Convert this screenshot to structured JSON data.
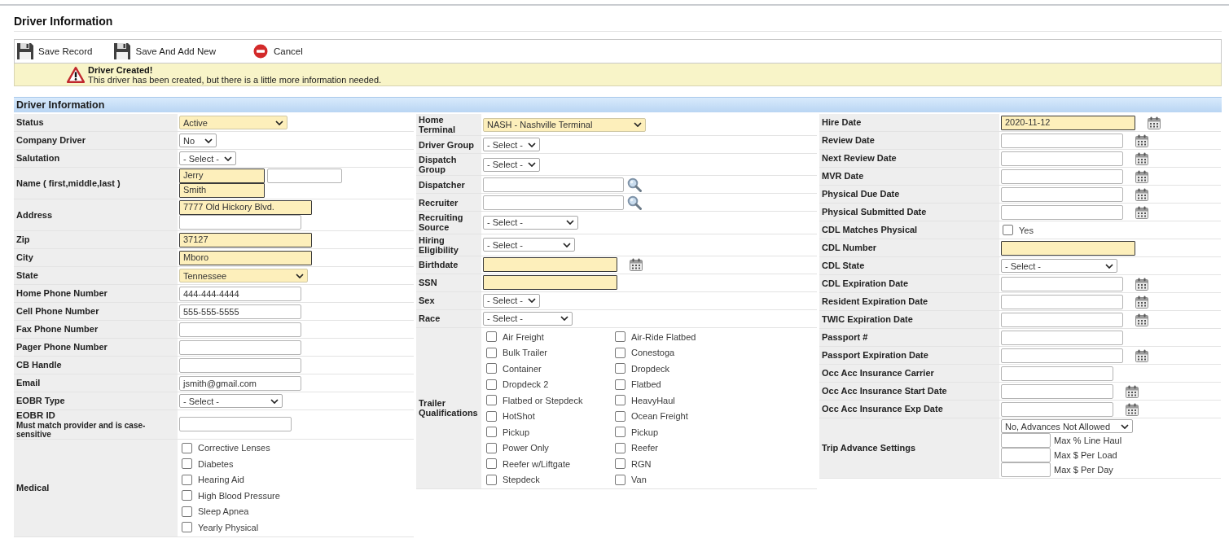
{
  "page": {
    "title": "Driver Information"
  },
  "toolbar": [
    {
      "kind": "save",
      "label": "Save Record"
    },
    {
      "kind": "save",
      "label": "Save And Add New"
    },
    {
      "kind": "cancel",
      "label": "Cancel"
    }
  ],
  "notice": {
    "kind": "warning",
    "title": "Driver Created!",
    "message": "This driver has been created, but there is a little more information needed."
  },
  "section": {
    "title": "Driver Information",
    "columns": [
      {
        "rows": [
          {
            "label": "Status",
            "fields": [
              {
                "kind": "select",
                "value": "Active",
                "required": true
              }
            ]
          },
          {
            "label": "Company Driver",
            "fields": [
              {
                "kind": "select",
                "value": "No",
                "required": false
              }
            ]
          },
          {
            "label": "Salutation",
            "fields": [
              {
                "kind": "select",
                "value": "- Select -",
                "required": false
              }
            ]
          },
          {
            "label": "Name ( first,middle,last )",
            "lines": [
              [
                {
                  "kind": "text",
                  "value": "Jerry",
                  "required": true
                },
                {
                  "kind": "text",
                  "required": false
                }
              ],
              [
                {
                  "kind": "text",
                  "value": "Smith",
                  "required": true
                }
              ]
            ]
          },
          {
            "label": "Address",
            "lines": [
              [
                {
                  "kind": "text",
                  "value": "7777 Old Hickory Blvd.",
                  "required": true
                }
              ],
              [
                {
                  "kind": "text",
                  "required": false
                }
              ]
            ]
          },
          {
            "label": "Zip",
            "fields": [
              {
                "kind": "text",
                "value": "37127",
                "required": true
              }
            ]
          },
          {
            "label": "City",
            "fields": [
              {
                "kind": "text",
                "value": "Mboro",
                "required": true
              }
            ]
          },
          {
            "label": "State",
            "fields": [
              {
                "kind": "select",
                "value": "Tennessee",
                "required": true
              }
            ]
          },
          {
            "label": "Home Phone Number",
            "fields": [
              {
                "kind": "text",
                "value": "444-444-4444",
                "required": false
              }
            ]
          },
          {
            "label": "Cell Phone Number",
            "fields": [
              {
                "kind": "text",
                "value": "555-555-5555",
                "required": false
              }
            ]
          },
          {
            "label": "Fax Phone Number",
            "fields": [
              {
                "kind": "text",
                "required": false
              }
            ]
          },
          {
            "label": "Pager Phone Number",
            "fields": [
              {
                "kind": "text",
                "required": false
              }
            ]
          },
          {
            "label": "CB Handle",
            "fields": [
              {
                "kind": "text",
                "required": false
              }
            ]
          },
          {
            "label": "Email",
            "fields": [
              {
                "kind": "text",
                "value": "jsmith@gmail.com",
                "required": false
              }
            ]
          },
          {
            "label": "EOBR Type",
            "fields": [
              {
                "kind": "select",
                "value": "- Select -",
                "required": false
              }
            ]
          },
          {
            "label": "EOBR ID",
            "note": "Must match provider and is case-sensitive",
            "fields": [
              {
                "kind": "text",
                "required": false
              }
            ]
          },
          {
            "label": "Medical",
            "fields": [
              {
                "kind": "checklist",
                "items": [
                  {
                    "label": "Corrective Lenses",
                    "checked": false
                  },
                  {
                    "label": "Diabetes",
                    "checked": false
                  },
                  {
                    "label": "Hearing Aid",
                    "checked": false
                  },
                  {
                    "label": "High Blood Pressure",
                    "checked": false
                  },
                  {
                    "label": "Sleep Apnea",
                    "checked": false
                  },
                  {
                    "label": "Yearly Physical",
                    "checked": false
                  }
                ]
              }
            ]
          }
        ]
      },
      {
        "rows": [
          {
            "label": "Home Terminal",
            "fields": [
              {
                "kind": "select",
                "value": "NASH - Nashville Terminal",
                "required": true
              }
            ]
          },
          {
            "label": "Driver Group",
            "fields": [
              {
                "kind": "select",
                "value": "- Select -",
                "required": false
              }
            ]
          },
          {
            "label": "Dispatch Group",
            "fields": [
              {
                "kind": "select",
                "value": "- Select -",
                "required": false
              }
            ]
          },
          {
            "label": "Dispatcher",
            "fields": [
              {
                "kind": "lookup",
                "required": false
              }
            ]
          },
          {
            "label": "Recruiter",
            "fields": [
              {
                "kind": "lookup",
                "required": false
              }
            ]
          },
          {
            "label": "Recruiting Source",
            "fields": [
              {
                "kind": "select",
                "value": "- Select -",
                "required": false
              }
            ]
          },
          {
            "label": "Hiring Eligibility",
            "fields": [
              {
                "kind": "select",
                "value": "- Select -",
                "required": false
              }
            ]
          },
          {
            "label": "Birthdate",
            "fields": [
              {
                "kind": "date",
                "required": true
              }
            ]
          },
          {
            "label": "SSN",
            "fields": [
              {
                "kind": "text",
                "required": true
              }
            ]
          },
          {
            "label": "Sex",
            "fields": [
              {
                "kind": "select",
                "value": "- Select -",
                "required": false
              }
            ]
          },
          {
            "label": "Race",
            "fields": [
              {
                "kind": "select",
                "value": "- Select -",
                "required": false
              }
            ]
          },
          {
            "label": "Trailer Qualifications",
            "fields": [
              {
                "kind": "checkgrid",
                "items": [
                  {
                    "label": "Air Freight",
                    "checked": false
                  },
                  {
                    "label": "Air-Ride Flatbed",
                    "checked": false
                  },
                  {
                    "label": "Bulk Trailer",
                    "checked": false
                  },
                  {
                    "label": "Conestoga",
                    "checked": false
                  },
                  {
                    "label": "Container",
                    "checked": false
                  },
                  {
                    "label": "Dropdeck",
                    "checked": false
                  },
                  {
                    "label": "Dropdeck 2",
                    "checked": false
                  },
                  {
                    "label": "Flatbed",
                    "checked": false
                  },
                  {
                    "label": "Flatbed or Stepdeck",
                    "checked": false
                  },
                  {
                    "label": "HeavyHaul",
                    "checked": false
                  },
                  {
                    "label": "HotShot",
                    "checked": false
                  },
                  {
                    "label": "Ocean Freight",
                    "checked": false
                  },
                  {
                    "label": "Pickup",
                    "checked": false
                  },
                  {
                    "label": "Pickup",
                    "checked": false
                  },
                  {
                    "label": "Power Only",
                    "checked": false
                  },
                  {
                    "label": "Reefer",
                    "checked": false
                  },
                  {
                    "label": "Reefer w/Liftgate",
                    "checked": false
                  },
                  {
                    "label": "RGN",
                    "checked": false
                  },
                  {
                    "label": "Stepdeck",
                    "checked": false
                  },
                  {
                    "label": "Van",
                    "checked": false
                  }
                ]
              }
            ]
          }
        ]
      },
      {
        "rows": [
          {
            "label": "Hire Date",
            "fields": [
              {
                "kind": "date",
                "value": "2020-11-12",
                "required": true
              }
            ]
          },
          {
            "label": "Review Date",
            "fields": [
              {
                "kind": "date",
                "required": false
              }
            ]
          },
          {
            "label": "Next Review Date",
            "fields": [
              {
                "kind": "date",
                "required": false
              }
            ]
          },
          {
            "label": "MVR Date",
            "fields": [
              {
                "kind": "date",
                "required": false
              }
            ]
          },
          {
            "label": "Physical Due Date",
            "fields": [
              {
                "kind": "date",
                "required": false
              }
            ]
          },
          {
            "label": "Physical Submitted Date",
            "fields": [
              {
                "kind": "date",
                "required": false
              }
            ]
          },
          {
            "label": "CDL Matches Physical",
            "fields": [
              {
                "kind": "checkbox",
                "label": "Yes",
                "checked": false
              }
            ]
          },
          {
            "label": "CDL Number",
            "fields": [
              {
                "kind": "text",
                "required": true
              }
            ]
          },
          {
            "label": "CDL State",
            "fields": [
              {
                "kind": "select",
                "value": "- Select -",
                "required": false
              }
            ]
          },
          {
            "label": "CDL Expiration Date",
            "fields": [
              {
                "kind": "date",
                "required": false
              }
            ]
          },
          {
            "label": "Resident Expiration Date",
            "fields": [
              {
                "kind": "date",
                "required": false
              }
            ]
          },
          {
            "label": "TWIC Expiration Date",
            "fields": [
              {
                "kind": "date",
                "required": false
              }
            ]
          },
          {
            "label": "Passport #",
            "fields": [
              {
                "kind": "text",
                "required": false
              }
            ]
          },
          {
            "label": "Passport Expiration Date",
            "fields": [
              {
                "kind": "date",
                "required": false
              }
            ]
          },
          {
            "label": "Occ Acc Insurance Carrier",
            "fields": [
              {
                "kind": "text",
                "required": false
              }
            ]
          },
          {
            "label": "Occ Acc Insurance Start Date",
            "fields": [
              {
                "kind": "date",
                "required": false
              }
            ]
          },
          {
            "label": "Occ Acc Insurance Exp Date",
            "fields": [
              {
                "kind": "date",
                "required": false
              }
            ]
          },
          {
            "label": "Trip Advance Settings",
            "lines": [
              [
                {
                  "kind": "select",
                  "value": "No, Advances Not Allowed",
                  "required": false
                }
              ],
              [
                {
                  "kind": "amount",
                  "caption": "Max % Line Haul",
                  "required": false
                }
              ],
              [
                {
                  "kind": "amount",
                  "caption": "Max $ Per Load",
                  "required": false
                }
              ],
              [
                {
                  "kind": "amount",
                  "caption": "Max $ Per Day",
                  "required": false
                }
              ]
            ]
          }
        ]
      }
    ]
  }
}
